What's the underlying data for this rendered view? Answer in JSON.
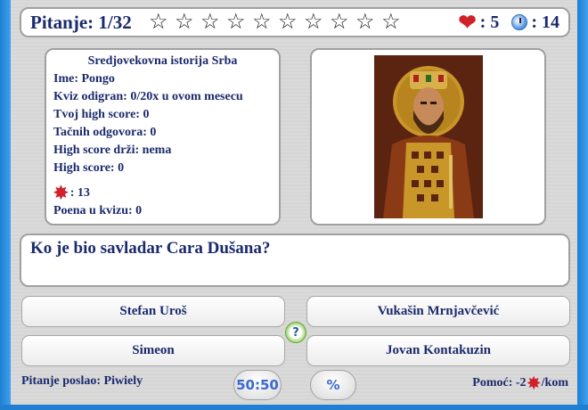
{
  "header": {
    "question_counter": "Pitanje: 1/32",
    "stars": [
      "☆",
      "☆",
      "☆",
      "☆",
      "☆",
      "☆",
      "☆",
      "☆",
      "☆",
      "☆"
    ],
    "lives": ": 5",
    "timer": ": 14"
  },
  "info": {
    "title": "Sredjovekovna istorija Srba",
    "name": "Ime: Pongo",
    "played": "Kviz odigran: 0/20x u ovom mesecu",
    "your_high_score": "Tvoj high score: 0",
    "correct_answers": "Tačnih odgovora: 0",
    "high_score_holder": "High score drži: nema",
    "high_score": "High score: 0",
    "help_count": ": 13",
    "points": "Poena u kvizu: 0"
  },
  "question": "Ko je bio savladar Cara Dušana?",
  "answers": [
    "Stefan Uroš",
    "Vukašin Mrnjavčević",
    "Simeon",
    "Jovan Kontakuzin"
  ],
  "footer": {
    "sent_by": "Pitanje poslao: Piwiely",
    "fifty_fifty": "50:50",
    "percent": "%",
    "help_prefix": "Pomoć: -2",
    "help_suffix": "/kom"
  },
  "colors": {
    "frame_blue": "#1f7fd0",
    "text_navy": "#1a2a6c",
    "heart_red": "#d0202a"
  },
  "icons": {
    "lives": "heart-icon",
    "timer": "clock-icon",
    "help": "burst-icon",
    "hint": "question-bubble-icon"
  }
}
